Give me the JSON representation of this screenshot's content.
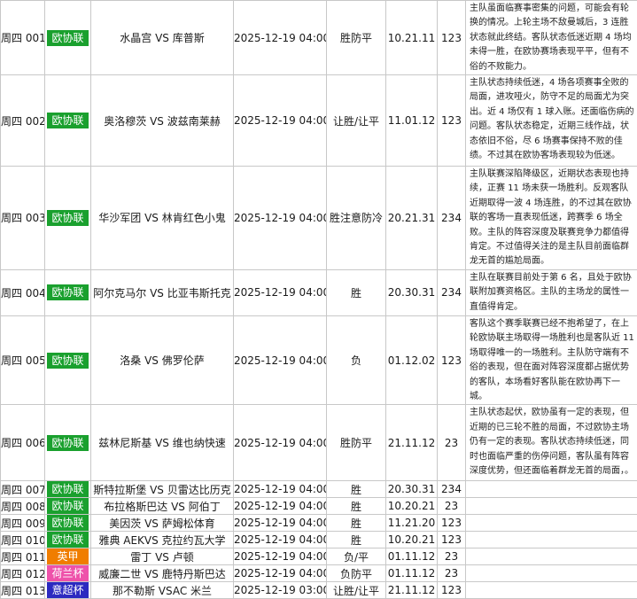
{
  "colors": {
    "欧协联": "#1aa02e",
    "英甲": "#f07d00",
    "荷兰杯": "#ee52aa",
    "意超杯": "#2c2ac0"
  },
  "matches": [
    {
      "id": "周四 001",
      "league": "欧协联",
      "teams": "水晶宫 VS 库普斯",
      "time": "2025-12-19 04:00",
      "pick": "胜防平",
      "odds": "10.21.11",
      "code": "123",
      "analysis": "主队虽面临赛事密集的问题，可能会有轮换的情况。上轮主场不敌曼城后，3 连胜状态就此终结。客队状态低迷近期 4 场均未得一胜，在欧协赛场表现平平，但有不俗的不败能力。"
    },
    {
      "id": "周四 002",
      "league": "欧协联",
      "teams": "奥洛穆茨 VS 波兹南莱赫",
      "time": "2025-12-19 04:00",
      "pick": "让胜/让平",
      "odds": "11.01.12",
      "code": "123",
      "analysis": "主队状态持续低迷，4 场各项赛事全败的局面，进攻哑火，防守不足的局面尤为突出。近 4 场仅有 1 球入账。还面临伤病的问题。客队状态稳定，近期三线作战，状态依旧不俗，尽 6 场赛事保持不败的佳绩。不过其在欧协客场表现较为低迷。"
    },
    {
      "id": "周四 003",
      "league": "欧协联",
      "teams": "华沙军团 VS 林肯红色小鬼",
      "time": "2025-12-19 04:00",
      "pick": "胜注意防冷",
      "odds": "20.21.31",
      "code": "234",
      "analysis": "主队联赛深陷降级区，近期状态表现也持续，正赛 11 场未获一场胜利。反观客队近期取得一波 4 场连胜，的不过其在欧协联的客场一直表现低迷，跨赛季 6 场全败。主队的阵容深度及联赛竞争力都值得肯定。不过值得关注的是主队目前面临群龙无首的尴尬局面。"
    },
    {
      "id": "周四 004",
      "league": "欧协联",
      "teams": "阿尔克马尔 VS 比亚韦斯托克",
      "time": "2025-12-19 04:00",
      "pick": "胜",
      "odds": "20.30.31",
      "code": "234",
      "analysis": "主队在联赛目前处于第 6 名，且处于欧协联附加赛资格区。主队的主场龙的属性一直值得肯定。"
    },
    {
      "id": "周四 005",
      "league": "欧协联",
      "teams": "洛桑 VS 佛罗伦萨",
      "time": "2025-12-19 04:00",
      "pick": "负",
      "odds": "01.12.02",
      "code": "123",
      "analysis": "客队这个赛季联赛已经不抱希望了，在上轮欧协联主场取得一场胜利也是客队近 11 场取得唯一的一场胜利。主队防守端有不俗的表现，但在面对阵容深度都占据优势的客队，本场看好客队能在欧协再下一城。"
    },
    {
      "id": "周四 006",
      "league": "欧协联",
      "teams": "兹林尼斯基 VS 维也纳快速",
      "time": "2025-12-19 04:00",
      "pick": "胜防平",
      "odds": "21.11.12",
      "code": "23",
      "analysis": "主队状态起伏，欧协虽有一定的表现，但近期的已三轮不胜的局面，不过欧协主场仍有一定的表现。客队状态持续低迷，同时也面临严重的伤停问题，客队虽有阵容深度优势，但还面临着群龙无首的局面，。"
    },
    {
      "id": "周四 007",
      "league": "欧协联",
      "teams": "斯特拉斯堡 VS 贝雷达比历克",
      "time": "2025-12-19 04:00",
      "pick": "胜",
      "odds": "20.30.31",
      "code": "234",
      "analysis": ""
    },
    {
      "id": "周四 008",
      "league": "欧协联",
      "teams": "布拉格斯巴达 VS 阿伯丁",
      "time": "2025-12-19 04:00",
      "pick": "胜",
      "odds": "10.20.21",
      "code": "23",
      "analysis": ""
    },
    {
      "id": "周四 009",
      "league": "欧协联",
      "teams": "美因茨 VS 萨姆松体育",
      "time": "2025-12-19 04:00",
      "pick": "胜",
      "odds": "11.21.20",
      "code": "123",
      "analysis": ""
    },
    {
      "id": "周四 010",
      "league": "欧协联",
      "teams": "雅典 AEKVS 克拉约瓦大学",
      "time": "2025-12-19 04:00",
      "pick": "胜",
      "odds": "10.20.21",
      "code": "123",
      "analysis": ""
    },
    {
      "id": "周四 011",
      "league": "英甲",
      "teams": "雷丁 VS 卢顿",
      "time": "2025-12-19 04:00",
      "pick": "负/平",
      "odds": "01.11.12",
      "code": "23",
      "analysis": ""
    },
    {
      "id": "周四 012",
      "league": "荷兰杯",
      "teams": "威廉二世 VS 鹿特丹斯巴达",
      "time": "2025-12-19 04:00",
      "pick": "负防平",
      "odds": "01.11.12",
      "code": "23",
      "analysis": ""
    },
    {
      "id": "周四 013",
      "league": "意超杯",
      "teams": "那不勒斯 VSAC 米兰",
      "time": "2025-12-19 03:00",
      "pick": "让胜/让平",
      "odds": "21.11.12",
      "code": "123",
      "analysis": ""
    }
  ]
}
